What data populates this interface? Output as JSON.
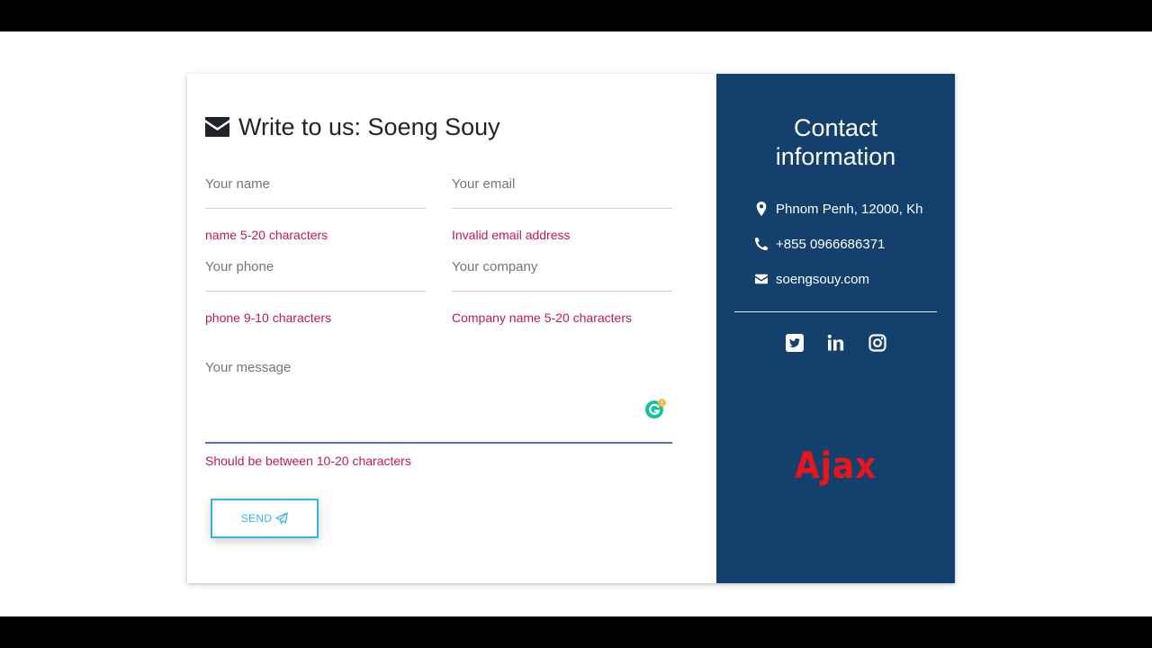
{
  "form": {
    "title": "Write to us: Soeng Souy",
    "fields": {
      "name": {
        "label": "Your name",
        "error": "name 5-20 characters"
      },
      "email": {
        "label": "Your email",
        "error": "Invalid email address"
      },
      "phone": {
        "label": "Your phone",
        "error": "phone 9-10 characters"
      },
      "company": {
        "label": "Your company",
        "error": "Company name 5-20 characters"
      },
      "message": {
        "label": "Your message",
        "error": "Should be between 10-20 characters"
      }
    },
    "send_label": "SEND"
  },
  "contact": {
    "title_line1": "Contact",
    "title_line2": "information",
    "address": "Phnom Penh, 12000, Kh",
    "phone": "+855 0966686371",
    "email": "soengsouy.com",
    "social": [
      "twitter-icon",
      "linkedin-icon",
      "instagram-icon"
    ]
  },
  "overlay_text": "Ajax",
  "colors": {
    "panel_bg": "#14406e",
    "error": "#c2185b",
    "button": "#33b5e5",
    "focus_line": "#4a73c9",
    "overlay": "#e8161b"
  }
}
